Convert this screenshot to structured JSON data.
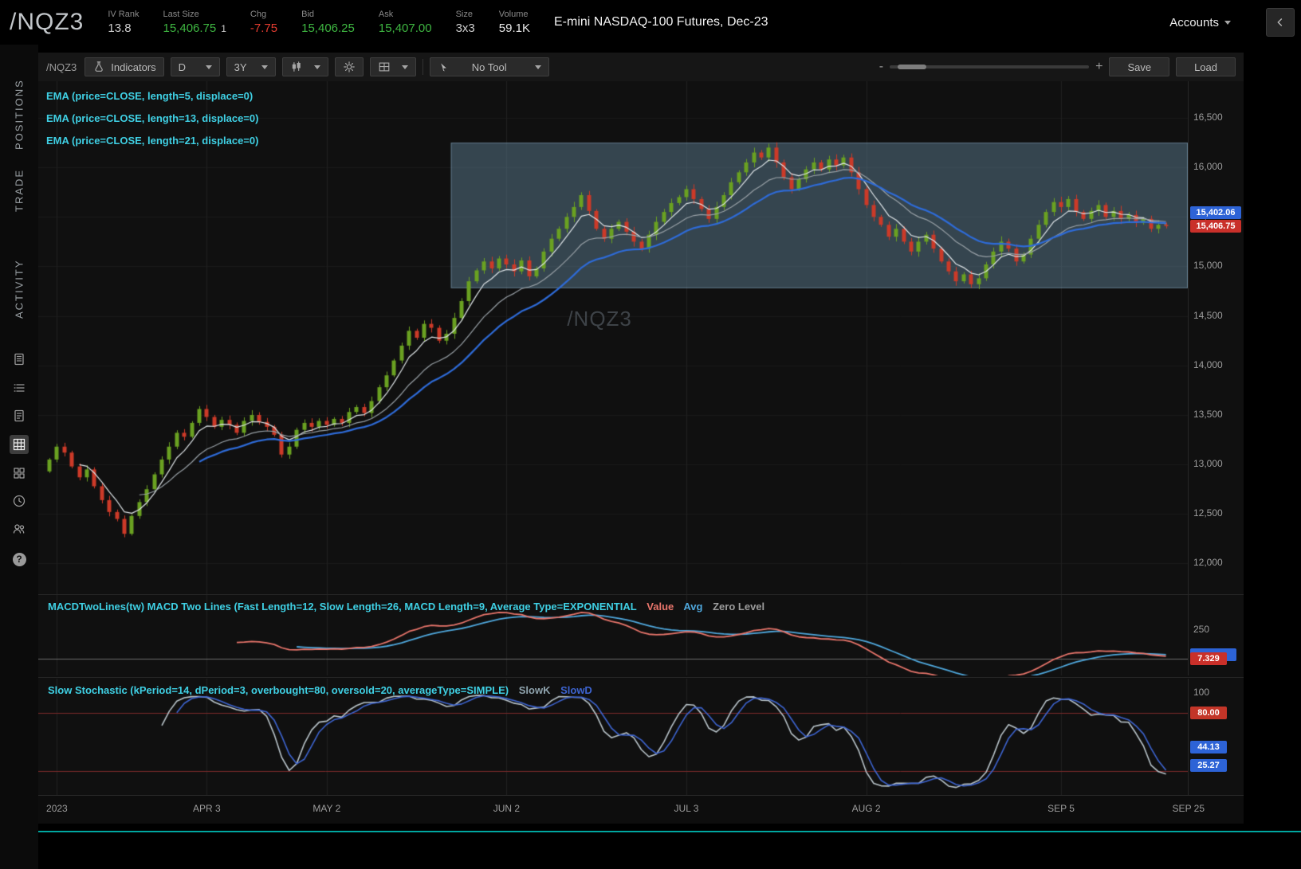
{
  "header": {
    "symbol": "/NQZ3",
    "stats": [
      {
        "label": "IV Rank",
        "value": "13.8",
        "color": "#cfcfcf"
      },
      {
        "label": "Last Size",
        "value": "15,406.75",
        "extra": "1",
        "color": "#3eb541"
      },
      {
        "label": "Chg",
        "value": "-7.75",
        "color": "#e23c30"
      },
      {
        "label": "Bid",
        "value": "15,406.25",
        "color": "#3eb541"
      },
      {
        "label": "Ask",
        "value": "15,407.00",
        "color": "#3eb541"
      },
      {
        "label": "Size",
        "value": "3x3",
        "color": "#cfcfcf"
      },
      {
        "label": "Volume",
        "value": "59.1K",
        "color": "#e8e8e8"
      }
    ],
    "description": "E-mini NASDAQ-100 Futures, Dec-23",
    "accounts_label": "Accounts"
  },
  "sidebar": {
    "tabs": [
      "POSITIONS",
      "TRADE",
      "ACTIVITY"
    ],
    "icons": [
      "calculator-icon",
      "list-icon",
      "order-ticket-icon",
      "grid-chart-icon",
      "dashboard-icon",
      "clock-icon",
      "people-icon",
      "help-icon"
    ],
    "active_icon": "grid-chart-icon",
    "help_glyph": "?"
  },
  "toolbar": {
    "symbol": "/NQZ3",
    "indicators": "Indicators",
    "timeframe": "D",
    "range": "3Y",
    "no_tool": "No Tool",
    "zoom_minus": "-",
    "zoom_plus": "+",
    "save": "Save",
    "load": "Load"
  },
  "studies": {
    "ema": [
      "EMA (price=CLOSE, length=5, displace=0)",
      "EMA (price=CLOSE, length=13, displace=0)",
      "EMA (price=CLOSE, length=21, displace=0)"
    ],
    "macd": {
      "title": "MACDTwoLines(tw) MACD Two Lines (Fast Length=12, Slow Length=26, MACD Length=9, Average Type=EXPONENTIAL",
      "value_label": "Value",
      "avg_label": "Avg",
      "zero_label": "Zero Level",
      "value_color": "#e8756b",
      "avg_color": "#4fa8dd",
      "zero_color": "#9c9c9c"
    },
    "stoch": {
      "title": "Slow Stochastic (kPeriod=14, dPeriod=3, overbought=80, oversold=20, averageType=SIMPLE)",
      "slowk_label": "SlowK",
      "slowd_label": "SlowD",
      "slowk_color": "#8fa3ad",
      "slowd_color": "#3d64d0"
    }
  },
  "chart": {
    "watermark": "/NQZ3"
  },
  "chart_data": {
    "type": "candlestick",
    "symbol": "/NQZ3",
    "interval": "D",
    "visible_range": "Jan 2023 - Sep 2023",
    "last_price": 15406.75,
    "closes": [
      13050,
      13180,
      13120,
      12980,
      12870,
      12950,
      12780,
      12640,
      12520,
      12450,
      12300,
      12480,
      12620,
      12750,
      12900,
      13050,
      13180,
      13320,
      13280,
      13420,
      13560,
      13480,
      13380,
      13450,
      13400,
      13320,
      13440,
      13500,
      13430,
      13380,
      13300,
      13100,
      13180,
      13350,
      13420,
      13380,
      13440,
      13400,
      13460,
      13420,
      13530,
      13580,
      13520,
      13640,
      13780,
      13900,
      14050,
      14200,
      14350,
      14280,
      14420,
      14380,
      14250,
      14320,
      14480,
      14650,
      14850,
      14960,
      15050,
      14980,
      15080,
      15020,
      14950,
      15060,
      14900,
      14980,
      15150,
      15280,
      15380,
      15500,
      15600,
      15720,
      15560,
      15380,
      15280,
      15380,
      15450,
      15350,
      15250,
      15180,
      15320,
      15450,
      15550,
      15640,
      15700,
      15780,
      15680,
      15580,
      15480,
      15600,
      15720,
      15850,
      15950,
      16050,
      16150,
      16100,
      16200,
      16050,
      15900,
      15780,
      15880,
      15980,
      16050,
      15980,
      16080,
      16020,
      16100,
      15950,
      15780,
      15620,
      15500,
      15420,
      15300,
      15380,
      15250,
      15150,
      15250,
      15320,
      15180,
      15050,
      14950,
      14850,
      14920,
      14820,
      14880,
      15020,
      15150,
      15250,
      15180,
      15050,
      15120,
      15280,
      15420,
      15550,
      15650,
      15600,
      15680,
      15550,
      15480,
      15560,
      15620,
      15500,
      15560,
      15480,
      15520,
      15440,
      15480,
      15380,
      15420,
      15406.75
    ],
    "layout": {
      "x_start": 14,
      "spacing": 9.4,
      "body_width": 5
    },
    "y_axis": {
      "min": 11690,
      "max": 16870,
      "ticks": [
        {
          "label": "16,500",
          "value": 16500
        },
        {
          "label": "16,000",
          "value": 16000
        },
        {
          "label": "15,500",
          "value": 15500
        },
        {
          "label": "15,000",
          "value": 15000
        },
        {
          "label": "14,500",
          "value": 14500
        },
        {
          "label": "14,000",
          "value": 14000
        },
        {
          "label": "13,500",
          "value": 13500
        },
        {
          "label": "13,000",
          "value": 13000
        },
        {
          "label": "12,500",
          "value": 12500
        },
        {
          "label": "12,000",
          "value": 12000
        }
      ]
    },
    "x_ticks": [
      {
        "label": "2023",
        "index": 1
      },
      {
        "label": "APR 3",
        "index": 21
      },
      {
        "label": "MAY 2",
        "index": 37
      },
      {
        "label": "JUN 2",
        "index": 61
      },
      {
        "label": "JUL 3",
        "index": 85
      },
      {
        "label": "AUG 2",
        "index": 109
      },
      {
        "label": "SEP 5",
        "index": 135
      },
      {
        "label": "SEP 25",
        "index": 152
      }
    ],
    "ema_lengths": [
      5,
      13,
      21
    ],
    "macd": {
      "fast_length": 12,
      "slow_length": 26,
      "macd_length": 9,
      "average_type": "EXPONENTIAL",
      "range": [
        -145,
        550
      ],
      "axis_tick": {
        "label": "250",
        "value": 250
      }
    },
    "stoch": {
      "k_period": 14,
      "d_period": 3,
      "overbought": 80,
      "oversold": 20,
      "average_type": "SIMPLE",
      "range": [
        -5,
        115
      ],
      "axis_tick": {
        "label": "100",
        "value": 100
      }
    },
    "rectangle": {
      "start_index": 54,
      "price_top": 16250,
      "price_bottom": 14780
    },
    "price_badges": {
      "blue_text": "15,402.06",
      "red_text": "15,406.75",
      "anchor_value": 15406.75
    },
    "macd_badges": {
      "red_text": "7.329",
      "anchor_value": 0
    },
    "stoch_badges": [
      {
        "text": "80.00",
        "bg": "#c33528",
        "value": 80
      },
      {
        "text": "44.13",
        "bg": "#2d63d6",
        "value": 44.13
      },
      {
        "text": "25.27",
        "bg": "#2d63d6",
        "value": 25.27
      }
    ],
    "colors": {
      "panel_bg": "#101010",
      "grid_h": "#1a1a1a",
      "grid_v": "#202020",
      "up": "#6aa121",
      "down": "#cc3a28",
      "ema5": "#dfe5e8",
      "ema13": "#98a0a6",
      "ema21": "#2e6bd8",
      "rect_fill": "rgba(104,142,168,0.42)",
      "rect_stroke": "rgba(150,185,210,0.45)",
      "macd_value": "#e8756b",
      "macd_avg": "#4fa8dd",
      "macd_zero": "#6a6a6a",
      "stoch_k": "#b9c4ca",
      "stoch_d": "#3d64d0",
      "stoch_level": "#7c2a2a",
      "badge_blue": "#2d63d6",
      "badge_red": "#c9302a",
      "axis_text": "#9c9c9c"
    }
  }
}
